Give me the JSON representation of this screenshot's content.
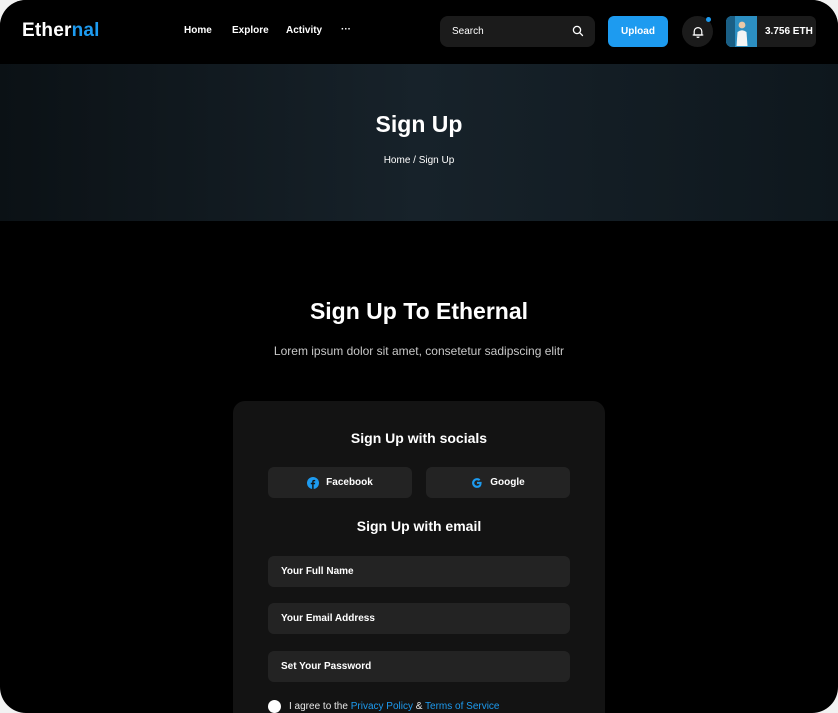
{
  "header": {
    "logo_main": "Ether",
    "logo_accent": "nal",
    "nav": [
      "Home",
      "Explore",
      "Activity",
      "···"
    ],
    "search_placeholder": "Search",
    "upload_label": "Upload",
    "balance": "3.756 ETH"
  },
  "hero": {
    "title": "Sign Up",
    "breadcrumb": "Home / Sign Up"
  },
  "main": {
    "title": "Sign Up To Ethernal",
    "subtitle": "Lorem ipsum dolor sit amet, consetetur sadipscing elitr"
  },
  "card": {
    "socials_heading": "Sign Up with socials",
    "facebook_label": "Facebook",
    "google_label": "Google",
    "email_heading": "Sign Up with email",
    "full_name_placeholder": "Your Full Name",
    "email_placeholder": "Your Email Address",
    "password_placeholder": "Set Your Password",
    "agree_prefix": "I agree to the",
    "privacy_link": "Privacy Policy",
    "ampersand": "&",
    "terms_link": "Terms of Service"
  },
  "colors": {
    "accent": "#1d9bf0",
    "background": "#000000",
    "card": "#131313",
    "field": "#232323"
  },
  "icons": {
    "search": "search-icon",
    "bell": "bell-icon",
    "facebook": "facebook-icon",
    "google": "google-icon"
  }
}
